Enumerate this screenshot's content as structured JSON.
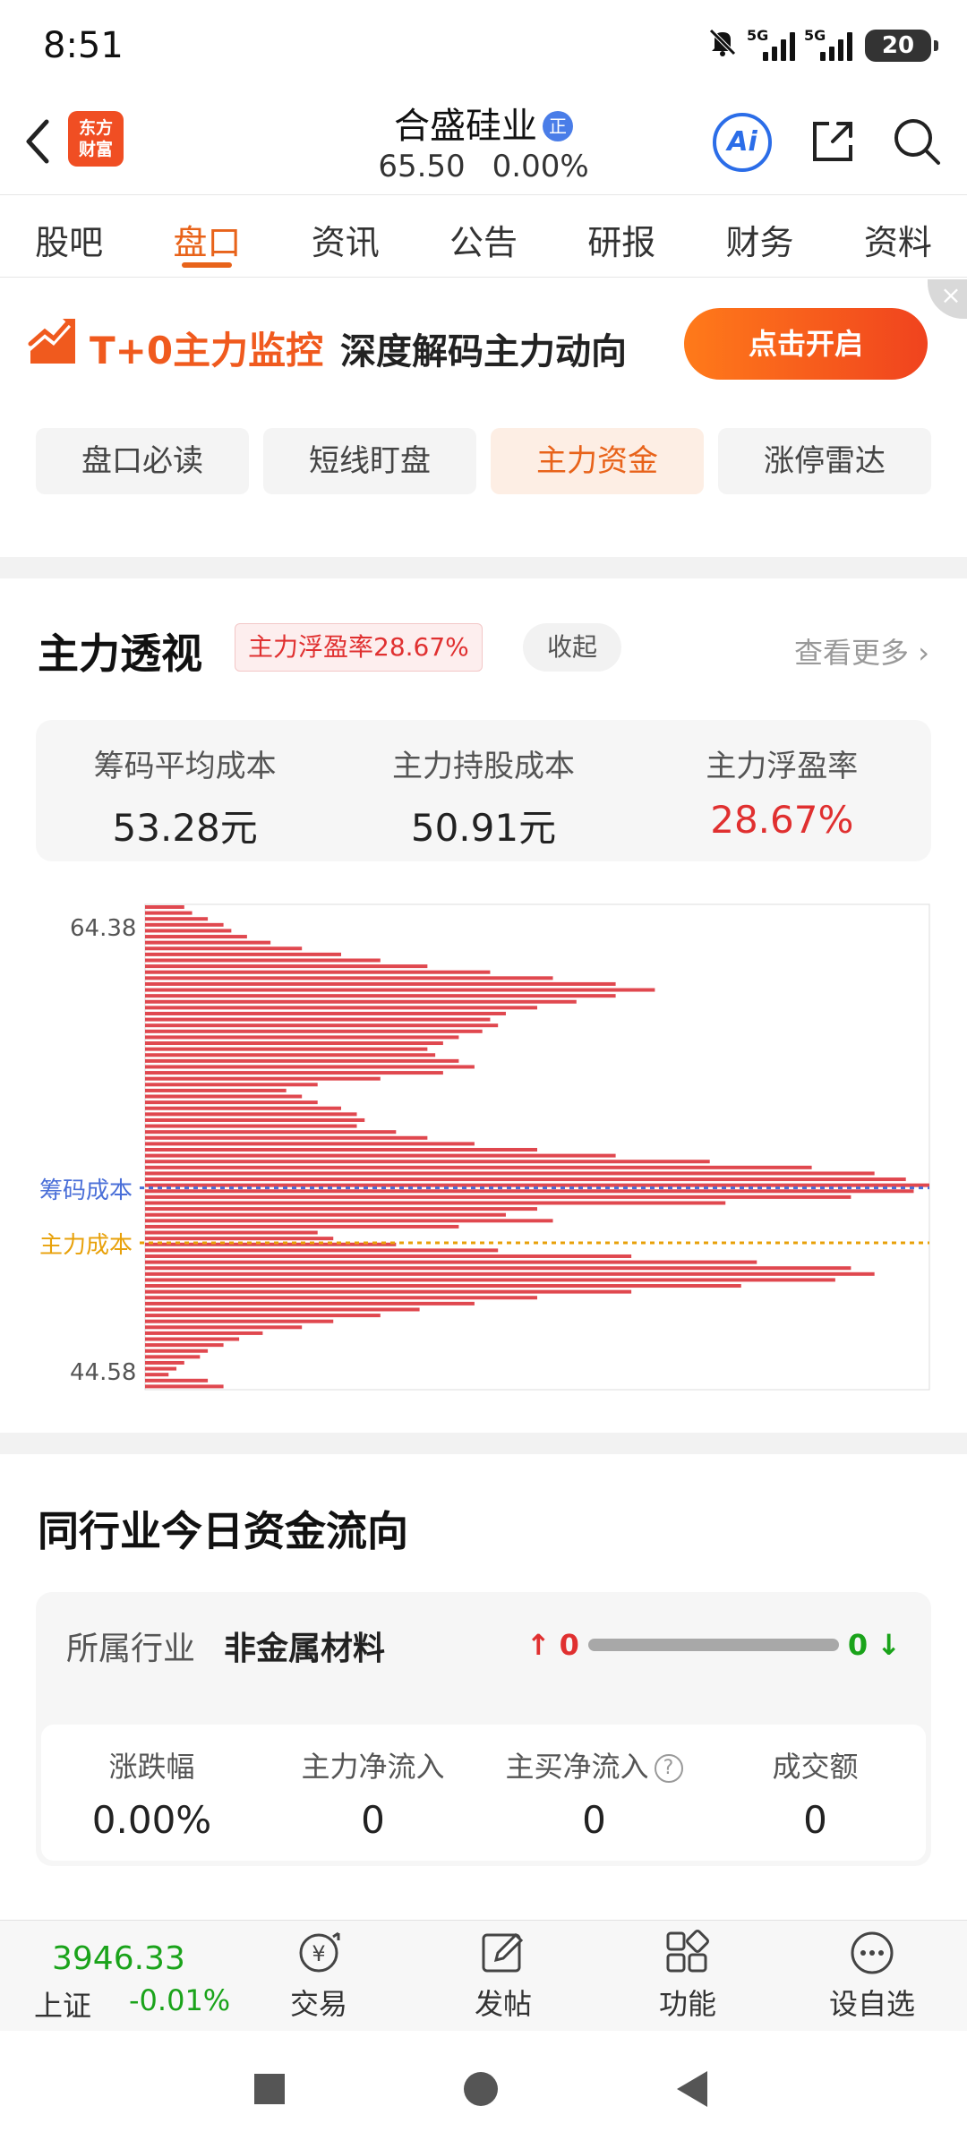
{
  "status": {
    "time": "8:51",
    "battery": "20",
    "net1": "5G",
    "net2": "5G"
  },
  "header": {
    "logo_line1": "东方",
    "logo_line2": "财富",
    "stock_name": "合盛硅业",
    "stock_tag": "正",
    "price": "65.50",
    "change": "0.00%",
    "ai_label": "Ai"
  },
  "tabs": [
    "股吧",
    "盘口",
    "资讯",
    "公告",
    "研报",
    "财务",
    "资料"
  ],
  "active_tab_index": 1,
  "promo": {
    "title_highlight": "T+0主力监控",
    "title_rest": "深度解码主力动向",
    "button": "点击开启",
    "close": "×"
  },
  "subtabs": [
    "盘口必读",
    "短线盯盘",
    "主力资金",
    "涨停雷达"
  ],
  "active_subtab_index": 2,
  "main_force": {
    "title": "主力透视",
    "tag": "主力浮盈率28.67%",
    "collapse": "收起",
    "more": "查看更多 ›",
    "stats": [
      {
        "label": "筹码平均成本",
        "value": "53.28元"
      },
      {
        "label": "主力持股成本",
        "value": "50.91元"
      },
      {
        "label": "主力浮盈率",
        "value": "28.67%"
      }
    ]
  },
  "chart_data": {
    "type": "bar",
    "orientation": "horizontal",
    "ylim": [
      44.58,
      65.5
    ],
    "ytick_labels": [
      "64.38",
      "44.58"
    ],
    "ytick_values": [
      64.38,
      44.58
    ],
    "reference_lines": [
      {
        "label": "筹码成本",
        "value": 53.28,
        "color": "#4a6fd8",
        "style": "dotted"
      },
      {
        "label": "主力成本",
        "value": 50.91,
        "color": "#e8a10a",
        "style": "dotted"
      }
    ],
    "bar_color": "#e0484f",
    "series": [
      {
        "relative_values": [
          0.05,
          0.06,
          0.08,
          0.1,
          0.11,
          0.13,
          0.16,
          0.2,
          0.25,
          0.3,
          0.36,
          0.44,
          0.52,
          0.6,
          0.65,
          0.6,
          0.55,
          0.5,
          0.46,
          0.44,
          0.45,
          0.43,
          0.4,
          0.38,
          0.36,
          0.37,
          0.4,
          0.42,
          0.38,
          0.3,
          0.22,
          0.18,
          0.2,
          0.22,
          0.25,
          0.27,
          0.28,
          0.27,
          0.32,
          0.36,
          0.42,
          0.5,
          0.6,
          0.72,
          0.85,
          0.93,
          0.97,
          1.0,
          0.98,
          0.9,
          0.74,
          0.5,
          0.46,
          0.52,
          0.4,
          0.22,
          0.24,
          0.32,
          0.45,
          0.62,
          0.78,
          0.9,
          0.93,
          0.88,
          0.76,
          0.62,
          0.5,
          0.42,
          0.35,
          0.3,
          0.24,
          0.2,
          0.15,
          0.12,
          0.1,
          0.08,
          0.07,
          0.05,
          0.04,
          0.03,
          0.08,
          0.1
        ]
      }
    ]
  },
  "industry": {
    "title": "同行业今日资金流向",
    "label": "所属行业",
    "name": "非金属材料",
    "up_count": "0",
    "down_count": "0",
    "stats": [
      {
        "label": "涨跌幅",
        "value": "0.00%"
      },
      {
        "label": "主力净流入",
        "value": "0"
      },
      {
        "label": "主买净流入",
        "value": "0"
      },
      {
        "label": "成交额",
        "value": "0"
      }
    ],
    "help": "?"
  },
  "bottom": {
    "index_value": "3946.33",
    "index_name": "上证",
    "index_change": "-0.01%",
    "nav": [
      "交易",
      "发帖",
      "功能",
      "设自选"
    ]
  },
  "colors": {
    "accent": "#e8631a",
    "red": "#e03030",
    "green": "#1aa31a",
    "blue": "#2b6de8"
  }
}
